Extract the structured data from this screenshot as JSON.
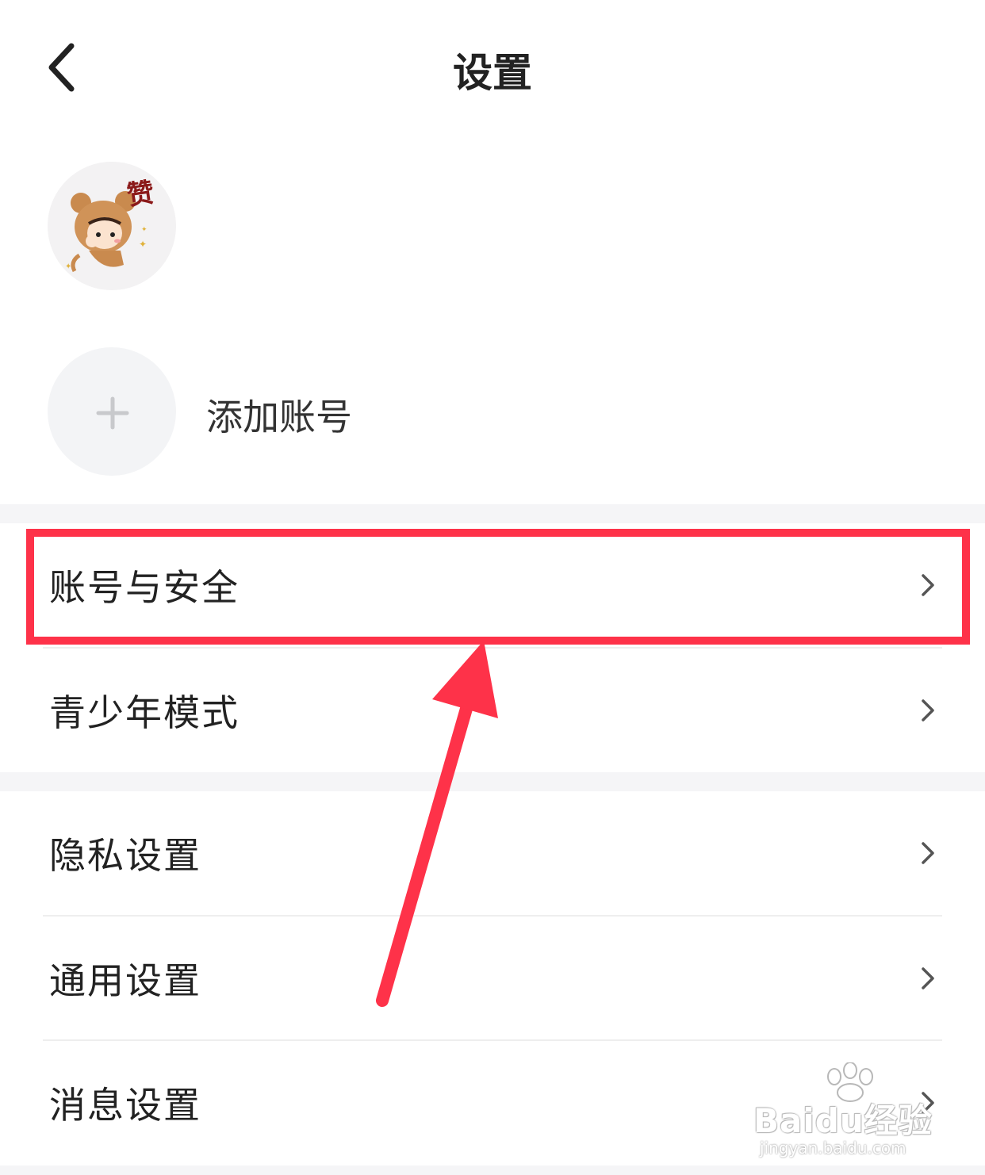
{
  "header": {
    "title": "设置",
    "back_icon": "chevron-left-icon"
  },
  "account": {
    "avatar_sticker_text": "赞"
  },
  "add_account": {
    "label": "添加账号",
    "icon": "plus-icon"
  },
  "groups": [
    {
      "items": [
        {
          "label": "账号与安全",
          "highlighted": true
        },
        {
          "label": "青少年模式"
        }
      ]
    },
    {
      "items": [
        {
          "label": "隐私设置"
        },
        {
          "label": "通用设置"
        },
        {
          "label": "消息设置"
        }
      ]
    }
  ],
  "annotation": {
    "highlight_color": "#fe3249",
    "arrow_color": "#fe3249"
  },
  "watermark": {
    "brand": "Baidu经验",
    "url": "jingyan.baidu.com"
  },
  "colors": {
    "background": "#ffffff",
    "section_gap": "#f5f5f7",
    "text": "#222222",
    "chevron": "#555555"
  }
}
